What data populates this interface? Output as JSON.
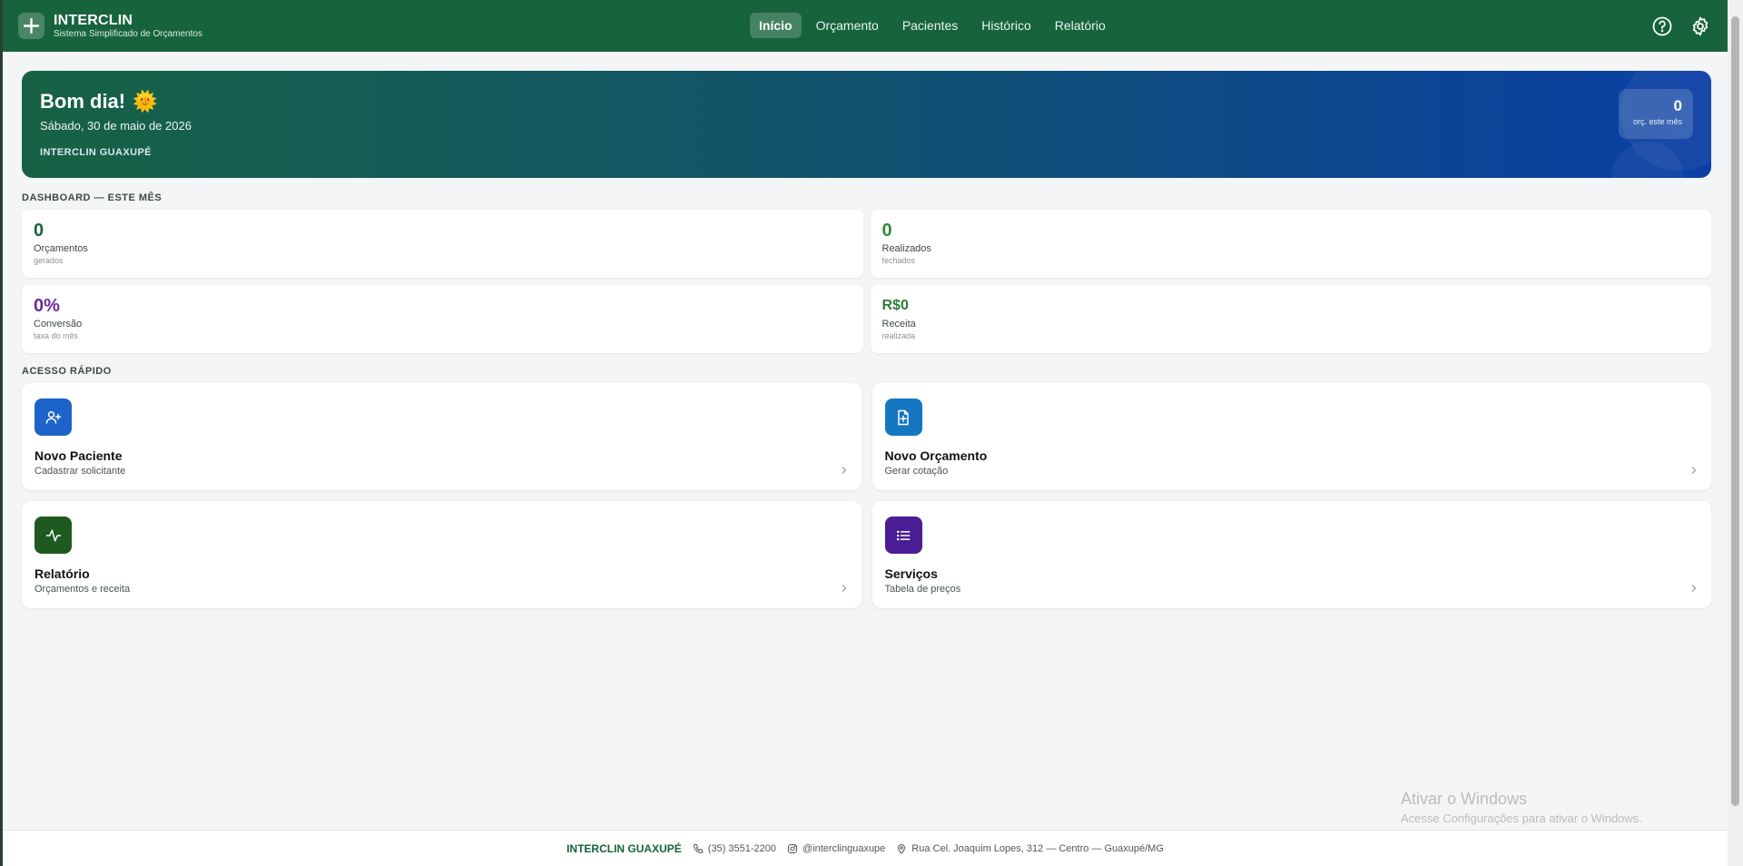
{
  "header": {
    "brand_title": "INTERCLIN",
    "brand_subtitle": "Sistema Simplificado de Orçamentos",
    "nav": [
      {
        "label": "Início",
        "active": true
      },
      {
        "label": "Orçamento",
        "active": false
      },
      {
        "label": "Pacientes",
        "active": false
      },
      {
        "label": "Histórico",
        "active": false
      },
      {
        "label": "Relatório",
        "active": false
      }
    ],
    "icons": [
      "help-icon",
      "gear-icon"
    ]
  },
  "hero": {
    "greeting": "Bom dia!",
    "greeting_emoji": "🌞",
    "date": "Sábado, 30 de maio de 2026",
    "clinic": "INTERCLIN GUAXUPÉ",
    "stat_value": "0",
    "stat_label": "orç. este mês"
  },
  "dashboard": {
    "title": "DASHBOARD — ESTE MÊS",
    "cards": [
      {
        "value": "0",
        "label": "Orçamentos",
        "sub": "gerados",
        "color": "#17633c"
      },
      {
        "value": "0",
        "label": "Realizados",
        "sub": "fechados",
        "color": "#2f8a3a"
      },
      {
        "value": "0%",
        "label": "Conversão",
        "sub": "taxa do mês",
        "color": "#6a2b9a"
      },
      {
        "value": "R$0",
        "label": "Receita",
        "sub": "realizada",
        "color": "#2f7a35"
      }
    ]
  },
  "quick": {
    "title": "ACESSO RÁPIDO",
    "items": [
      {
        "title": "Novo Paciente",
        "sub": "Cadastrar solicitante",
        "icon": "user-plus-icon",
        "color": "#1c64c9"
      },
      {
        "title": "Novo Orçamento",
        "sub": "Gerar cotação",
        "icon": "file-plus-icon",
        "color": "#1577c2"
      },
      {
        "title": "Relatório",
        "sub": "Orçamentos e receita",
        "icon": "activity-icon",
        "color": "#1e5a1f"
      },
      {
        "title": "Serviços",
        "sub": "Tabela de preços",
        "icon": "list-icon",
        "color": "#4b1d94"
      }
    ]
  },
  "footer": {
    "brand": "INTERCLIN GUAXUPÉ",
    "phone": "(35) 3551-2200",
    "instagram": "@interclinguaxupe",
    "address": "Rua Cel. Joaquim Lopes, 312 — Centro — Guaxupé/MG"
  },
  "watermark": {
    "line1": "Ativar o Windows",
    "line2": "Acesse Configurações para ativar o Windows."
  }
}
